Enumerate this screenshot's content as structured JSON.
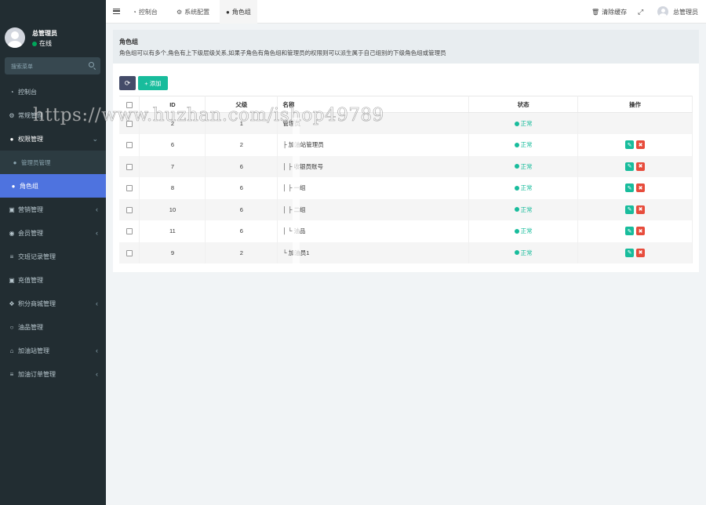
{
  "sidebar": {
    "user_name": "总管理员",
    "user_status": "在线",
    "search_placeholder": "搜索菜单",
    "items": [
      {
        "label": "控制台",
        "icon": "dashboard-icon"
      },
      {
        "label": "常规管理",
        "icon": "cogs-icon"
      },
      {
        "label": "权限管理",
        "icon": "users-icon"
      },
      {
        "label": "管理员管理",
        "icon": "user-icon"
      },
      {
        "label": "角色组",
        "icon": "group-icon"
      },
      {
        "label": "营销管理",
        "icon": "money-icon"
      },
      {
        "label": "会员管理",
        "icon": "user-circle-icon"
      },
      {
        "label": "交班记录管理",
        "icon": "list-icon"
      },
      {
        "label": "充值管理",
        "icon": "money-icon"
      },
      {
        "label": "积分商城管理",
        "icon": "cubes-icon"
      },
      {
        "label": "油品管理",
        "icon": "circle-icon"
      },
      {
        "label": "加油站管理",
        "icon": "bank-icon"
      },
      {
        "label": "加油订单管理",
        "icon": "list-icon"
      }
    ]
  },
  "topbar": {
    "tabs": [
      {
        "label": "控制台",
        "icon": "dashboard-icon"
      },
      {
        "label": "系统配置",
        "icon": "gear-icon"
      },
      {
        "label": "角色组",
        "icon": "group-icon"
      }
    ],
    "clear_cache": "清除缓存",
    "admin_name": "总管理员"
  },
  "panel": {
    "title": "角色组",
    "description": "角色组可以有多个,角色有上下级层级关系,如果子角色有角色组和管理员的权限则可以派生属于自己组别的下级角色组或管理员"
  },
  "toolbar": {
    "add_label": "添加"
  },
  "table": {
    "headers": {
      "id": "ID",
      "parent": "父级",
      "name": "名称",
      "status": "状态",
      "ops": "操作"
    },
    "rows": [
      {
        "id": "2",
        "parent": "1",
        "name": "管理员",
        "status": "正常",
        "ops": false
      },
      {
        "id": "6",
        "parent": "2",
        "name": "├ 加油站管理员",
        "status": "正常",
        "ops": true
      },
      {
        "id": "7",
        "parent": "6",
        "name": "│ ├ 收银员账号",
        "status": "正常",
        "ops": true
      },
      {
        "id": "8",
        "parent": "6",
        "name": "│ ├ 一组",
        "status": "正常",
        "ops": true
      },
      {
        "id": "10",
        "parent": "6",
        "name": "│ ├ 二组",
        "status": "正常",
        "ops": true
      },
      {
        "id": "11",
        "parent": "6",
        "name": "│ └ 油品",
        "status": "正常",
        "ops": true
      },
      {
        "id": "9",
        "parent": "2",
        "name": "└ 加油员1",
        "status": "正常",
        "ops": true
      }
    ]
  },
  "watermark": "https://www.huzhan.com/ishop49789",
  "colors": {
    "sidebar": "#222d32",
    "active": "#4e73df",
    "success": "#18bc9c",
    "danger": "#e74c3c",
    "primary_dark": "#444c69"
  }
}
